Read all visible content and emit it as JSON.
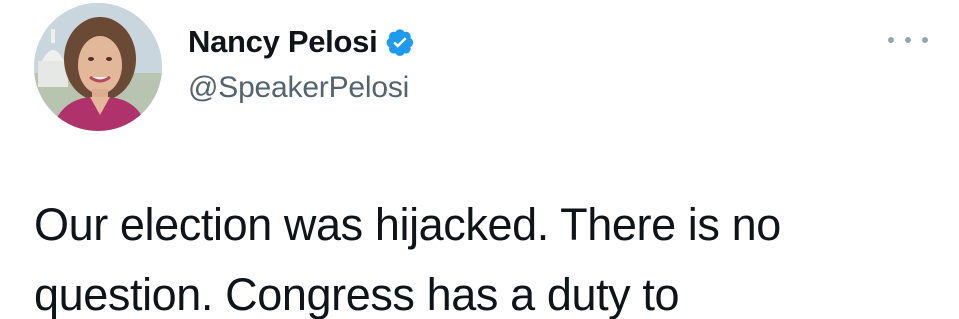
{
  "author": {
    "display_name": "Nancy Pelosi",
    "handle": "@SpeakerPelosi",
    "verified": true
  },
  "tweet": {
    "text": "Our election was hijacked. There is no\nquestion. Congress has a duty to"
  },
  "icons": {
    "verified": "verified-badge-icon",
    "more": "more-options-icon"
  },
  "colors": {
    "verified_badge": "#1d9bf0",
    "handle": "#536471",
    "text": "#0f1419"
  }
}
